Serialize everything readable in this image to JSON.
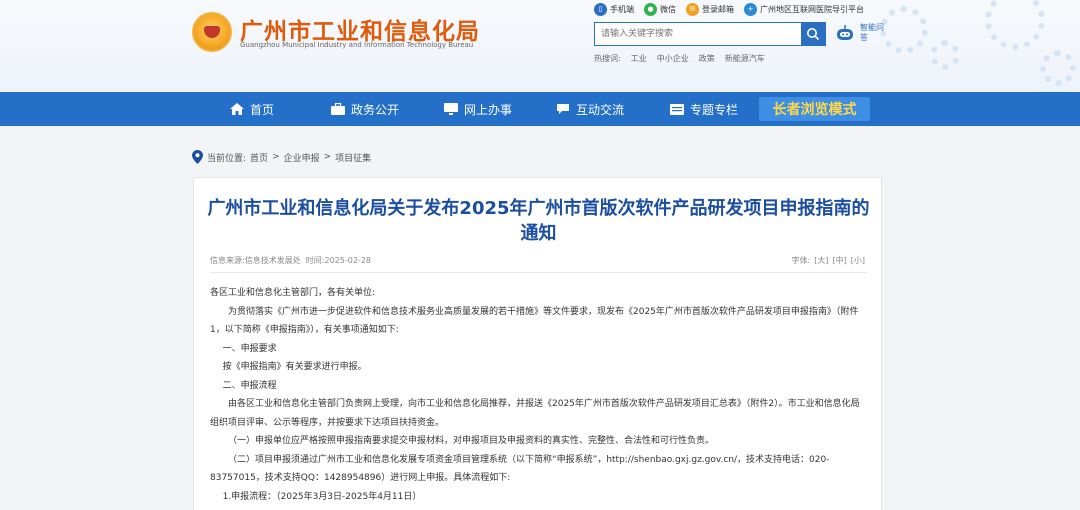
{
  "header": {
    "logo_cn": "广州市工业和信息化局",
    "logo_en": "Guangzhou Municipal Industry and Information Technology Bureau",
    "top_links": [
      "手机端",
      "微信",
      "登录邮箱",
      "广州地区互联网医院导引平台"
    ],
    "search_placeholder": "请输入关键字搜索",
    "hot_label": "热搜词:",
    "hot_words": [
      "工业",
      "中小企业",
      "政策",
      "新能源汽车"
    ],
    "assistant_label": "智能问答"
  },
  "nav": {
    "items": [
      "首页",
      "政务公开",
      "网上办事",
      "互动交流",
      "专题专栏"
    ],
    "elder_mode": "长者浏览模式"
  },
  "breadcrumb": {
    "label": "当前位置:",
    "items": [
      "首页",
      "企业申报",
      "项目征集"
    ],
    "separator": ">"
  },
  "article": {
    "title": "广州市工业和信息化局关于发布2025年广州市首版次软件产品研发项目申报指南的通知",
    "source_label": "信息来源:",
    "source": "信息技术发展处",
    "time_label": "时间:",
    "time": "2025-02-28",
    "font_label": "字体:",
    "font_sizes": [
      "[大]",
      "[中]",
      "[小]"
    ],
    "paragraphs": [
      "各区工业和信息化主管部门，各有关单位:",
      "为贯彻落实《广州市进一步促进软件和信息技术服务业高质量发展的若干措施》等文件要求，现发布《2025年广州市首版次软件产品研发项目申报指南》（附件1，以下简称《申报指南》），有关事项通知如下:",
      "一、申报要求",
      "按《申报指南》有关要求进行申报。",
      "二、申报流程",
      "由各区工业和信息化主管部门负责网上受理，向市工业和信息化局推荐，并报送《2025年广州市首版次软件产品研发项目汇总表》（附件2）。市工业和信息化局组织项目评审、公示等程序，并按要求下达项目扶持资金。",
      "（一）申报单位应严格按照申报指南要求提交申报材料，对申报项目及申报资料的真实性、完整性、合法性和可行性负责。",
      "（二）项目申报须通过广州市工业和信息化发展专项资金项目管理系统（以下简称“申报系统”，http://shenbao.gxj.gz.gov.cn/，技术支持电话：020-83757015，技术支持QQ：1428954896）进行网上申报。具体流程如下:",
      "1.申报流程：（2025年3月3日-2025年4月11日）"
    ]
  },
  "colors": {
    "nav_bg": "#2470c9",
    "title": "#1b4ea0",
    "logo_text": "#e05a0c",
    "elder_text": "#ffd84a"
  }
}
